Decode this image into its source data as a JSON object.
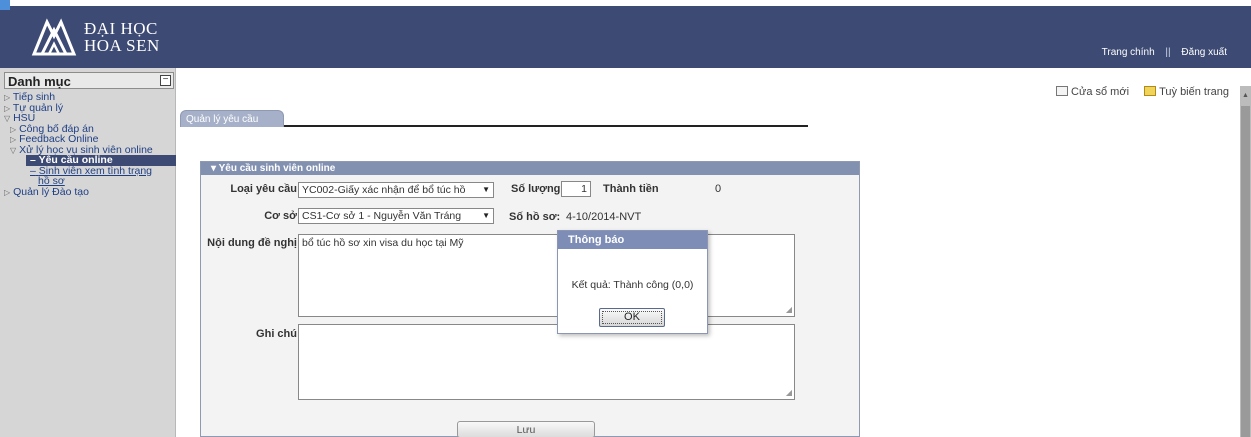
{
  "header": {
    "logo_line1": "ĐẠI HỌC",
    "logo_line2": "HOA SEN",
    "links": {
      "home": "Trang chính",
      "separator": "||",
      "logout": "Đăng xuất"
    },
    "bg_color": "#3c4a74"
  },
  "sidebar": {
    "title": "Danh mục",
    "collapse_symbol": "−",
    "items": [
      {
        "label": "Tiếp sinh",
        "marker": "▷"
      },
      {
        "label": "Tự quản lý",
        "marker": "▷"
      },
      {
        "label": "HSU",
        "marker": "▽"
      },
      {
        "label": "Công bố đáp án",
        "marker": "▷"
      },
      {
        "label": "Feedback Online",
        "marker": "▷"
      },
      {
        "label": "Xử lý học vụ sinh viên online",
        "marker": "▽"
      },
      {
        "label": "Yêu cầu online",
        "marker": "–"
      },
      {
        "label": "Sinh viên xem tình trạng",
        "marker": "–"
      },
      {
        "label": "hồ sơ",
        "marker": ""
      },
      {
        "label": "Quản lý Đào tạo",
        "marker": "▷"
      }
    ]
  },
  "toolbar": {
    "new_window": "Cửa sổ mới",
    "customize": "Tuỳ biến trang"
  },
  "tab": {
    "label": "Quản lý yêu cầu"
  },
  "form": {
    "panel_title": "Yêu cầu sinh viên online",
    "request_type_label": "Loại yêu cầu",
    "request_type_value": "YC002-Giấy xác nhận để bổ túc hồ",
    "quantity_label": "Số lượng",
    "quantity_value": "1",
    "amount_label": "Thành tiền",
    "amount_value": "0",
    "campus_label": "Cơ sở",
    "campus_value": "CS1-Cơ sở 1 - Nguyễn Văn Tráng",
    "file_no_label": "Số hồ sơ:",
    "file_no_value": "4-10/2014-NVT",
    "content_label": "Nội dung đề nghị",
    "content_value": "bổ túc hồ sơ xin visa du học tại Mỹ",
    "note_label": "Ghi chú",
    "note_value": "",
    "save_label": "Lưu"
  },
  "dialog": {
    "title": "Thông báo",
    "message": "Kết quả: Thành công (0,0)",
    "ok_label": "OK"
  }
}
